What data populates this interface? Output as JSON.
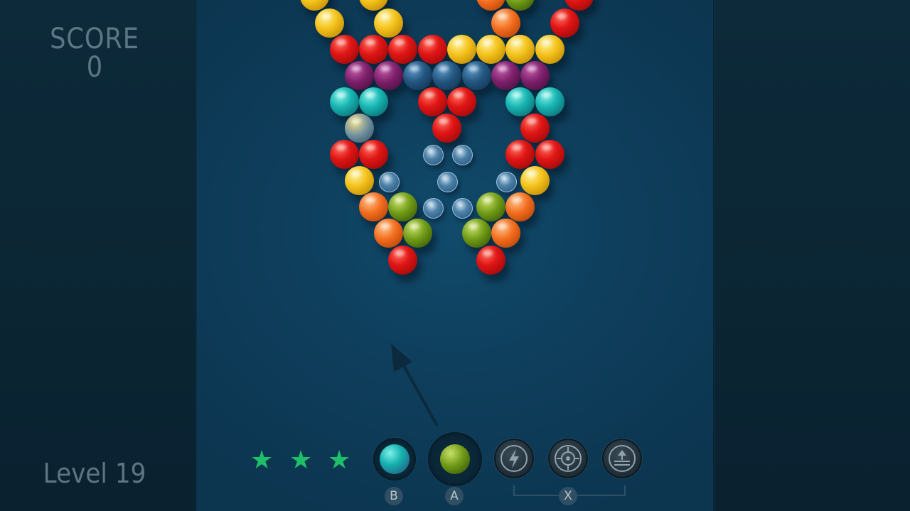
{
  "hud": {
    "score_label": "SCORE",
    "score_value": "0",
    "level_label": "Level",
    "level_number": "19"
  },
  "rating": {
    "stars": 3,
    "star_color": "#1fbf6a"
  },
  "shooter": {
    "next_bubble_color": "teal",
    "current_bubble_color": "green",
    "swap_key": "B",
    "fire_key": "A"
  },
  "powerups": {
    "items": [
      "lightning-icon",
      "target-icon",
      "upload-icon"
    ],
    "key": "X"
  },
  "bubble_colors": {
    "red": "#e01515",
    "yellow": "#f4c21a",
    "orange": "#f26b1c",
    "purple": "#7c1f6a",
    "blue": "#22557e",
    "teal": "#16b3b0",
    "green": "#6f9a16",
    "glass": "#a8d0f0"
  },
  "board": {
    "rows": [
      [
        "yellow",
        "yellow",
        "orange",
        "green",
        "red"
      ],
      [
        "yellow",
        "yellow",
        "orange",
        "red"
      ],
      [
        "red",
        "red",
        "red",
        "red",
        "yellow",
        "yellow",
        "yellow",
        "yellow"
      ],
      [
        "purple",
        "purple",
        "blue",
        "blue",
        "blue",
        "purple",
        "purple"
      ],
      [
        "teal",
        "teal",
        "red",
        "red",
        "teal",
        "teal"
      ],
      [
        "grey",
        "red",
        "red"
      ],
      [
        "red",
        "red",
        "glass",
        "glass",
        "red",
        "red"
      ],
      [
        "yellow",
        "glass",
        "glass",
        "glass",
        "yellow"
      ],
      [
        "orange",
        "green",
        "glass",
        "glass",
        "green",
        "orange"
      ],
      [
        "orange",
        "green",
        "green",
        "orange"
      ],
      [
        "red",
        "red"
      ]
    ]
  }
}
